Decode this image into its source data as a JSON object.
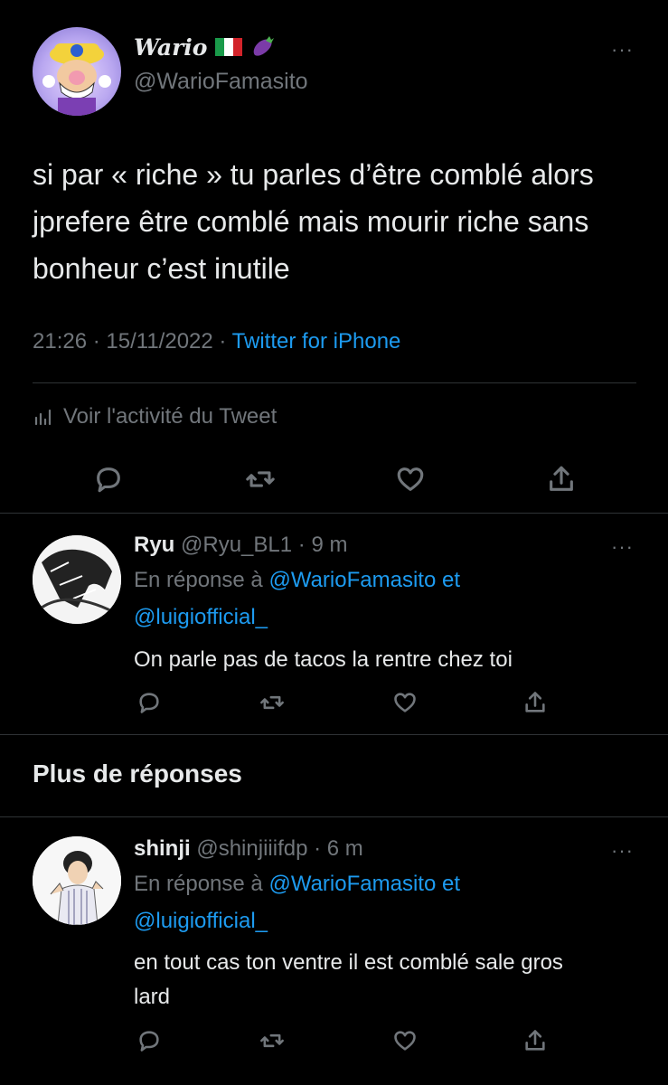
{
  "main_tweet": {
    "display_name": "Wario",
    "flag_icon": "italy-flag-icon",
    "emoji_icon": "eggplant-icon",
    "handle": "@WarioFamasito",
    "text": "si par « riche » tu parles d’être comblé alors jprefere être comblé mais mourir riche sans bonheur c’est inutile",
    "time": "21:26",
    "date": "15/11/2022",
    "source": "Twitter for iPhone",
    "activity_label": "Voir l'activité du Tweet"
  },
  "replies": [
    {
      "name": "Ryu",
      "handle": "@Ryu_BL1",
      "time": "9 m",
      "in_reply_prefix": "En réponse à",
      "in_reply_user1": "@WarioFamasito",
      "in_reply_and": "et",
      "in_reply_user2": "@luigiofficial_",
      "text": "On parle pas de tacos la rentre chez toi"
    },
    {
      "name": "shinji",
      "handle": "@shinjiiifdp",
      "time": "6 m",
      "in_reply_prefix": "En réponse à",
      "in_reply_user1": "@WarioFamasito",
      "in_reply_and": "et",
      "in_reply_user2": "@luigiofficial_",
      "text": "en tout cas ton ventre il est comblé sale gros lard"
    }
  ],
  "more_replies_title": "Plus de réponses",
  "separator": "·",
  "more_glyph": "···",
  "colors": {
    "background": "#000000",
    "text": "#e7e9ea",
    "muted": "#71767b",
    "link": "#1d9bf0",
    "divider": "#2f3336"
  }
}
